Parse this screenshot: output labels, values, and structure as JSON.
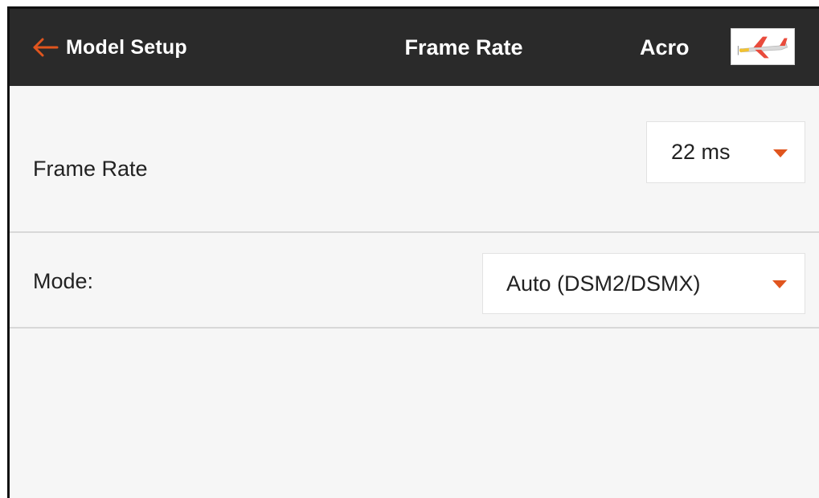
{
  "colors": {
    "accent": "#e0551e",
    "topbar_bg": "#2a2a2a",
    "page_bg": "#f6f6f6",
    "text": "#222222"
  },
  "header": {
    "back_icon": "arrow-left-icon",
    "back_label": "Model Setup",
    "title": "Frame Rate",
    "model_name": "Acro",
    "model_image_icon": "airplane-thumbnail-icon"
  },
  "settings": {
    "frame_rate": {
      "label": "Frame Rate",
      "value": "22 ms",
      "caret_icon": "caret-down-icon"
    },
    "mode": {
      "label": "Mode:",
      "value": "Auto (DSM2/DSMX)",
      "caret_icon": "caret-down-icon"
    }
  }
}
